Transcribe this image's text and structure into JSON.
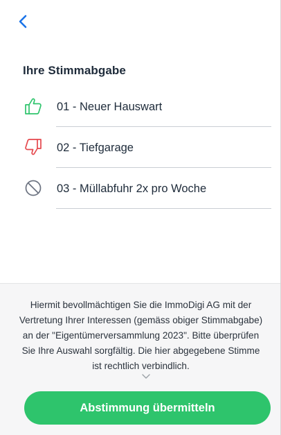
{
  "header": {
    "back_icon": "chevron-left-icon",
    "accent_color": "#1a73e8"
  },
  "section": {
    "title": "Ihre Stimmabgabe"
  },
  "votes": [
    {
      "label": "01 - Neuer Hauswart",
      "choice": "yes",
      "icon": "thumbs-up-icon",
      "color": "#2ec46c"
    },
    {
      "label": "02 - Tiefgarage",
      "choice": "no",
      "icon": "thumbs-down-icon",
      "color": "#e5484d"
    },
    {
      "label": "03 - Müllabfuhr 2x pro Woche",
      "choice": "abstain",
      "icon": "abstain-icon",
      "color": "#6b7280"
    }
  ],
  "footer": {
    "consent_text": "Hiermit bevollmächtigen Sie die ImmoDigi AG mit der Vertretung Ihrer Interessen (gemäss obiger Stimmabgabe) an der \"Eigentümerversammlung 2023\". Bitte überprüfen Sie Ihre Auswahl sorgfältig. Die hier abgegebene Stimme ist rechtlich verbindlich.",
    "scroll_icon": "chevron-down-icon",
    "submit_label": "Abstimmung übermitteln",
    "submit_color": "#2ec46c"
  }
}
